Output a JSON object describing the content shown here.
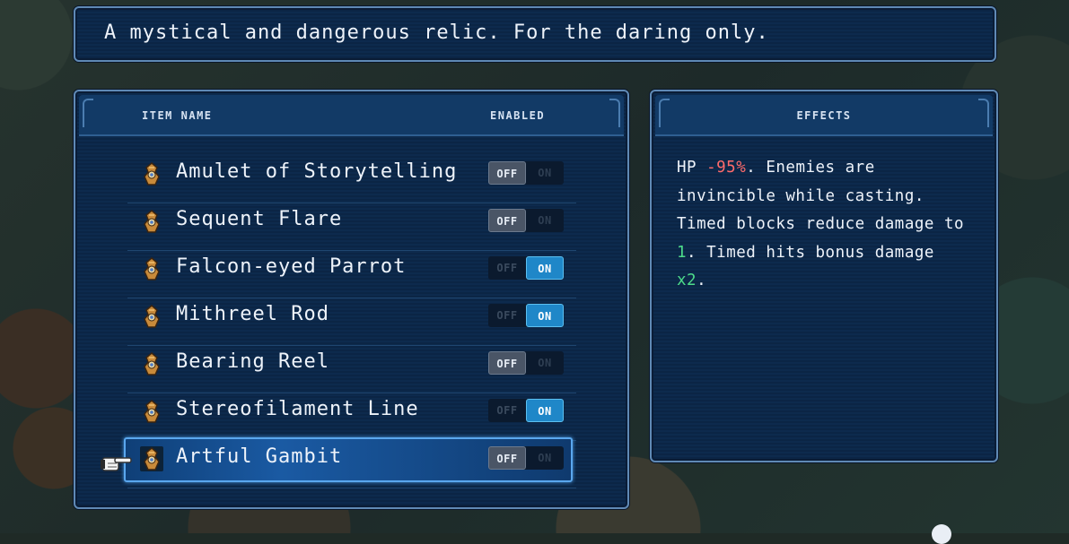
{
  "description": "A mystical and dangerous relic. For the daring only.",
  "list": {
    "col_item_name": "ITEM NAME",
    "col_enabled": "ENABLED",
    "toggle_off_label": "OFF",
    "toggle_on_label": "ON",
    "items": [
      {
        "label": "Amulet of Storytelling",
        "enabled": false
      },
      {
        "label": "Sequent Flare",
        "enabled": false
      },
      {
        "label": "Falcon-eyed Parrot",
        "enabled": true
      },
      {
        "label": "Mithreel Rod",
        "enabled": true
      },
      {
        "label": "Bearing Reel",
        "enabled": false
      },
      {
        "label": "Stereofilament Line",
        "enabled": true
      },
      {
        "label": "Artful Gambit",
        "enabled": false,
        "selected": true
      }
    ]
  },
  "effects": {
    "title": "EFFECTS",
    "hp_prefix": "HP ",
    "hp_value": "-95%",
    "line_a": ". Enemies are invincible while casting. Timed blocks reduce damage to ",
    "block_value": "1",
    "line_b": ". Timed hits bonus damage ",
    "hit_value": "x2",
    "line_end": "."
  },
  "colors": {
    "negative": "#ff6b6b",
    "positive": "#4ddb8a",
    "toggle_on": "#1f87c8",
    "selection": "#5aa7ee"
  },
  "icons": {
    "item": "relic-icon",
    "cursor": "pointing-hand-icon"
  }
}
